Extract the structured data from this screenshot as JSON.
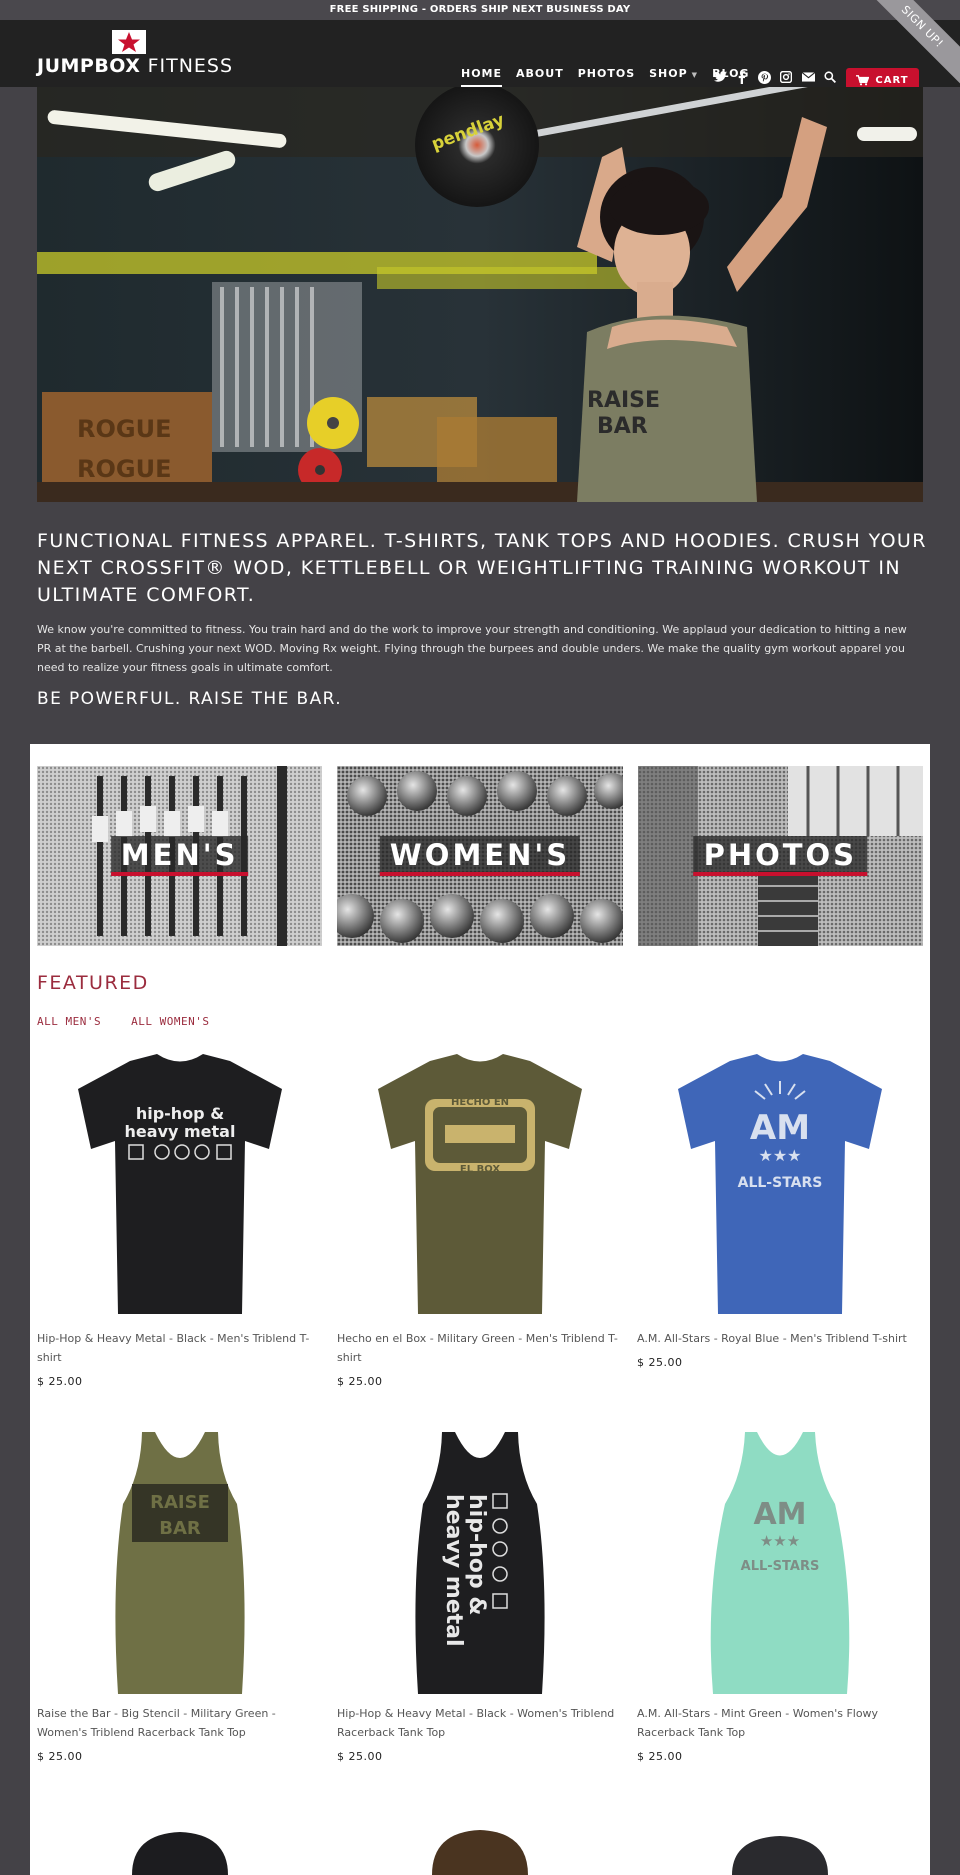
{
  "promo": {
    "text": "FREE SHIPPING - ORDERS SHIP NEXT BUSINESS DAY"
  },
  "signup": {
    "label": "SIGN UP!"
  },
  "logo": {
    "bold": "JUMPBOX",
    "thin": "FITNESS"
  },
  "nav": {
    "items": [
      {
        "label": "HOME"
      },
      {
        "label": "ABOUT"
      },
      {
        "label": "PHOTOS"
      },
      {
        "label": "SHOP"
      },
      {
        "label": "BLOG"
      }
    ],
    "cart_label": "CART"
  },
  "intro": {
    "title": "FUNCTIONAL FITNESS APPAREL. T-SHIRTS, TANK TOPS AND HOODIES.  CRUSH YOUR NEXT CROSSFIT® WOD, KETTLEBELL OR WEIGHTLIFTING TRAINING WORKOUT IN ULTIMATE COMFORT.",
    "body": "We know you're committed to fitness. You train hard and do the work to improve your strength and conditioning. We applaud your dedication to hitting a new PR at the barbell. Crushing your next WOD. Moving Rx weight. Flying through the burpees and double unders. We make the quality gym workout apparel you need to realize your fitness goals in ultimate comfort.",
    "tagline": "BE POWERFUL. RAISE THE BAR."
  },
  "collections": [
    {
      "label": "MEN'S"
    },
    {
      "label": "WOMEN'S"
    },
    {
      "label": "PHOTOS"
    }
  ],
  "featured": {
    "title": "FEATURED",
    "links": [
      "ALL MEN'S",
      "ALL WOMEN'S"
    ]
  },
  "products": [
    {
      "name": "Hip-Hop & Heavy Metal - Black - Men's Triblend T-shirt",
      "price": "$ 25.00",
      "color": "#1e1e20",
      "print": "hip-hop & heavy metal"
    },
    {
      "name": "Hecho en el Box - Military Green - Men's Triblend T-shirt",
      "price": "$ 25.00",
      "color": "#5d5a38",
      "print": "HECHO EN EL BOX"
    },
    {
      "name": "A.M. All-Stars - Royal Blue - Men's Triblend T-shirt",
      "price": "$ 25.00",
      "color": "#3f66b8",
      "print": "AM ALL-STARS"
    },
    {
      "name": "Raise the Bar - Big Stencil - Military Green - Women's Triblend Racerback Tank Top",
      "price": "$ 25.00",
      "color": "#6f7045",
      "print": "RAISE THE BAR"
    },
    {
      "name": "Hip-Hop & Heavy Metal - Black - Women's Triblend Racerback Tank Top",
      "price": "$ 25.00",
      "color": "#1e1e20",
      "print": "hip-hop & heavy metal"
    },
    {
      "name": "A.M. All-Stars - Mint Green - Women's Flowy Racerback Tank Top",
      "price": "$ 25.00",
      "color": "#8fdcc3",
      "print": "AM ALL-STARS"
    }
  ]
}
